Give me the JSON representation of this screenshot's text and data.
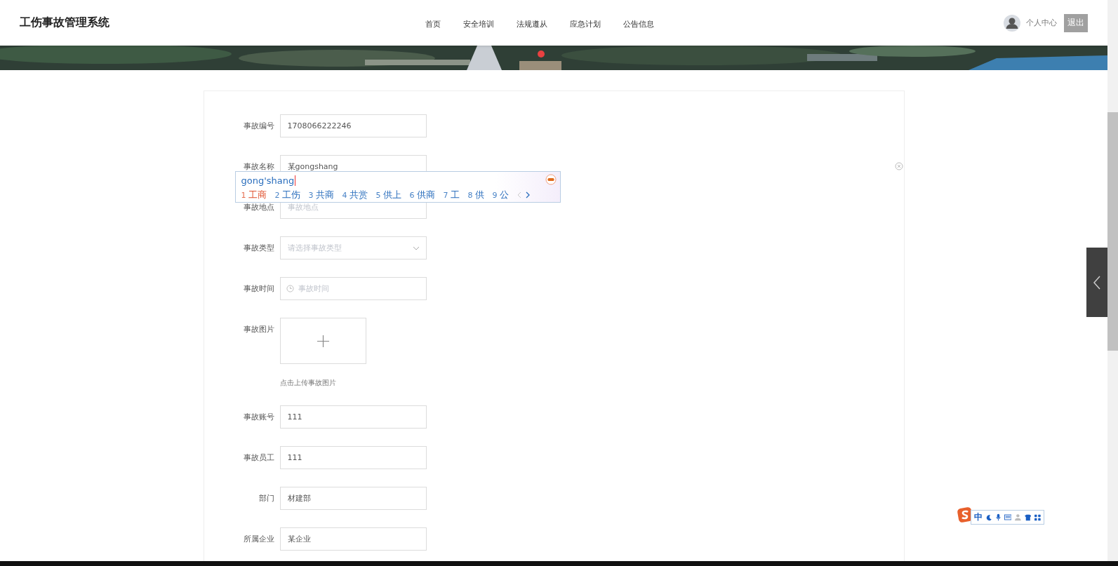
{
  "header": {
    "title": "工伤事故管理系统",
    "nav": [
      {
        "label": "首页",
        "selected": false
      },
      {
        "label": "安全培训",
        "selected": false
      },
      {
        "label": "法规遵从",
        "selected": false
      },
      {
        "label": "应急计划",
        "selected": false
      },
      {
        "label": "公告信息",
        "selected": false
      }
    ],
    "user": "个人中心",
    "logout": "退出"
  },
  "form": {
    "fields": [
      {
        "kind": "text",
        "label": "事故编号",
        "value": "1708066222246"
      },
      {
        "kind": "text",
        "label": "事故名称",
        "value": "某gongshang",
        "clearable": true,
        "ime": {
          "composition": "gong'shang",
          "candidates": [
            {
              "index": "1",
              "text": "工商",
              "selected": true
            },
            {
              "index": "2",
              "text": "工伤",
              "selected": false
            },
            {
              "index": "3",
              "text": "共商",
              "selected": false
            },
            {
              "index": "4",
              "text": "共赏",
              "selected": false
            },
            {
              "index": "5",
              "text": "供上",
              "selected": false
            },
            {
              "index": "6",
              "text": "供商",
              "selected": false
            },
            {
              "index": "7",
              "text": "工",
              "selected": false
            },
            {
              "index": "8",
              "text": "供",
              "selected": false
            },
            {
              "index": "9",
              "text": "公",
              "selected": false
            }
          ]
        }
      },
      {
        "kind": "text",
        "label": "事故地点",
        "placeholder": "事故地点"
      },
      {
        "kind": "select",
        "label": "事故类型",
        "placeholder": "请选择事故类型"
      },
      {
        "kind": "date",
        "label": "事故时间",
        "placeholder": "事故时间"
      },
      {
        "kind": "upload",
        "label": "事故图片",
        "hint": "点击上传事故图片"
      },
      {
        "kind": "text",
        "label": "事故账号",
        "value": "111"
      },
      {
        "kind": "text",
        "label": "事故员工",
        "value": "111"
      },
      {
        "kind": "text",
        "label": "部门",
        "value": "材建部"
      },
      {
        "kind": "text",
        "label": "所属企业",
        "value": "某企业"
      }
    ]
  },
  "ime_toolbar": {
    "mode": "中"
  }
}
